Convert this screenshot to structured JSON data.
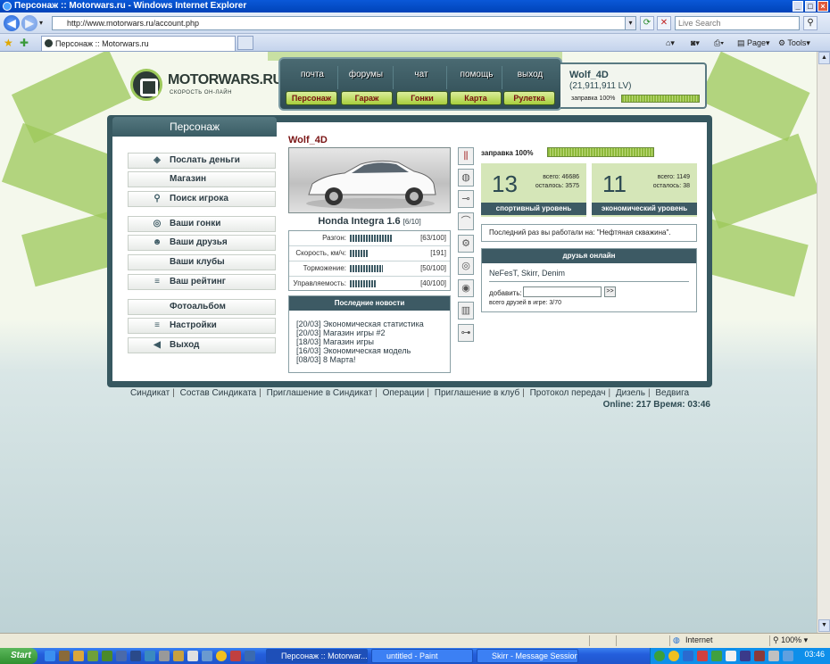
{
  "window": {
    "title": "Персонаж :: Motorwars.ru - Windows Internet Explorer",
    "min": "_",
    "max": "□",
    "close": "×"
  },
  "browser": {
    "url": "http://www.motorwars.ru/account.php",
    "search_placeholder": "Live Search",
    "tab_title": "Персонаж :: Motorwars.ru",
    "toolbar": {
      "page": "Page",
      "tools": "Tools"
    }
  },
  "site": {
    "logo_text": "MOTORWARS.RU",
    "logo_sub": "СКОРОСТЬ ОН-ЛАЙН",
    "top_menu": [
      "почта",
      "форумы",
      "чат",
      "помощь",
      "выход"
    ],
    "green_menu": [
      "Персонаж",
      "Гараж",
      "Гонки",
      "Карта",
      "Рулетка"
    ],
    "user": {
      "name": "Wolf_4D",
      "balance": "(21,911,911 LV)",
      "fuel_label": "заправка 100%",
      "fuel": 1.0
    }
  },
  "panel": {
    "tab_label": "Персонаж",
    "left_menu": [
      {
        "label": "Послать деньги",
        "icon": "◈"
      },
      {
        "label": "Магазин",
        "icon": ""
      },
      {
        "label": "Поиск игрока",
        "icon": "⚲"
      },
      {
        "label": "Ваши гонки",
        "icon": "◎"
      },
      {
        "label": "Ваши друзья",
        "icon": "☻"
      },
      {
        "label": "Ваши клубы",
        "icon": ""
      },
      {
        "label": "Ваш рейтинг",
        "icon": "≡"
      },
      {
        "label": "Фотоальбом",
        "icon": ""
      },
      {
        "label": "Настройки",
        "icon": "≡"
      },
      {
        "label": "Выход",
        "icon": "◀"
      }
    ],
    "char_name": "Wolf_4D",
    "car": {
      "name": "Honda Integra 1.6",
      "slots": "[6/10]"
    },
    "stats": [
      {
        "label": "Разгон:",
        "value": "[63/100]",
        "fill": 0.63
      },
      {
        "label": "Скорость, км/ч:",
        "value": "[191]",
        "fill": 0.28
      },
      {
        "label": "Торможение:",
        "value": "[50/100]",
        "fill": 0.5
      },
      {
        "label": "Управляемость:",
        "value": "[40/100]",
        "fill": 0.4
      }
    ],
    "news": {
      "header": "Последние новости",
      "items": [
        "[20/03] Экономическая статистика",
        "[20/03] Магазин игры #2",
        "[18/03] Магазин игры",
        "[16/03] Экономическая модель",
        "[08/03] 8 Марта!"
      ]
    },
    "fuel_label": "заправка 100%",
    "fuel": 1.0,
    "sport": {
      "level": "13",
      "total_label": "всего:",
      "total": "46686",
      "left_label": "осталось:",
      "left": "3575",
      "caption": "спортивный уровень"
    },
    "econ": {
      "level": "11",
      "total_label": "всего:",
      "total": "1149",
      "left_label": "осталось:",
      "left": "38",
      "caption": "экономический уровень"
    },
    "last_work": "Последний раз вы работали на: \"Нефтяная скважина\".",
    "friends": {
      "header": "друзья онлайн",
      "list": "NeFesT, Skirr, Denim",
      "add_label": "добавить:",
      "add_btn": ">>",
      "total": "всего друзей в игре: 3/70"
    }
  },
  "footer": {
    "links": [
      "Синдикат",
      "Состав Синдиката",
      "Приглашение в Синдикат",
      "Операции",
      "Приглашение в клуб",
      "Протокол передач",
      "Дизель",
      "Ведвига"
    ],
    "online": "Online: 217  Время: 03:46"
  },
  "statusbar": {
    "zone": "Internet",
    "zoom": "100%"
  },
  "taskbar": {
    "start": "Start",
    "tasks": [
      "Персонаж :: Motorwar...",
      "untitled - Paint",
      "Skirr - Message Session (..."
    ],
    "clock": "03:46"
  }
}
